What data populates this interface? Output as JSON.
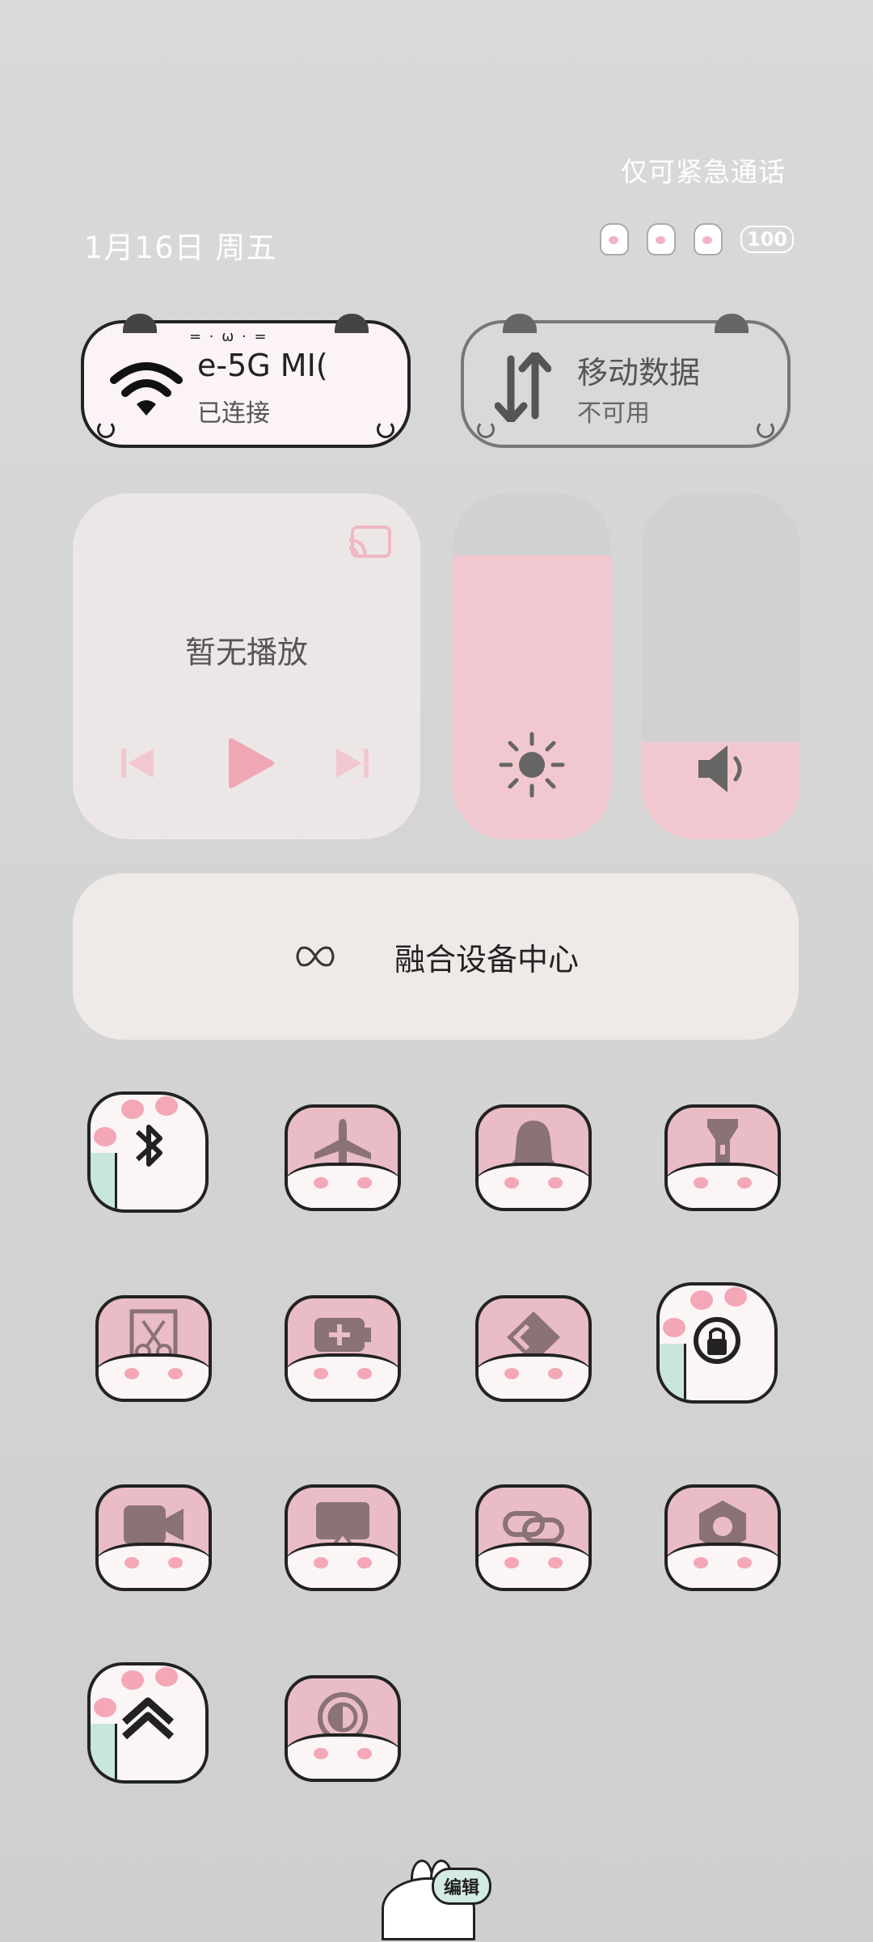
{
  "status": {
    "emergency_text": "仅可紧急通话",
    "date_text": "1月16日 周五",
    "battery_level": "100"
  },
  "wifi_card": {
    "title": "e-5G      MI(",
    "subtitle": "已连接",
    "face": "= · ω · ="
  },
  "data_card": {
    "title": "移动数据",
    "subtitle": "不可用"
  },
  "media": {
    "label": "暂无播放"
  },
  "brightness": {
    "level": 0.82
  },
  "volume": {
    "level": 0.28
  },
  "fusion": {
    "label": "融合设备中心"
  },
  "tiles": [
    {
      "icon": "bluetooth-icon"
    },
    {
      "icon": "airplane-icon"
    },
    {
      "icon": "bell-icon"
    },
    {
      "icon": "flashlight-icon"
    },
    {
      "icon": "screenshot-icon"
    },
    {
      "icon": "battery-saver-icon"
    },
    {
      "icon": "nfc-icon"
    },
    {
      "icon": "rotation-lock-icon"
    },
    {
      "icon": "screen-record-icon"
    },
    {
      "icon": "projection-icon"
    },
    {
      "icon": "link-icon"
    },
    {
      "icon": "settings-icon"
    },
    {
      "icon": "stack-icon"
    },
    {
      "icon": "eye-comfort-icon"
    }
  ],
  "edit": {
    "label": "编辑"
  },
  "colors": {
    "accent_pink": "#f2c8d0",
    "outline": "#222222",
    "card_cream": "#ece7e6"
  }
}
